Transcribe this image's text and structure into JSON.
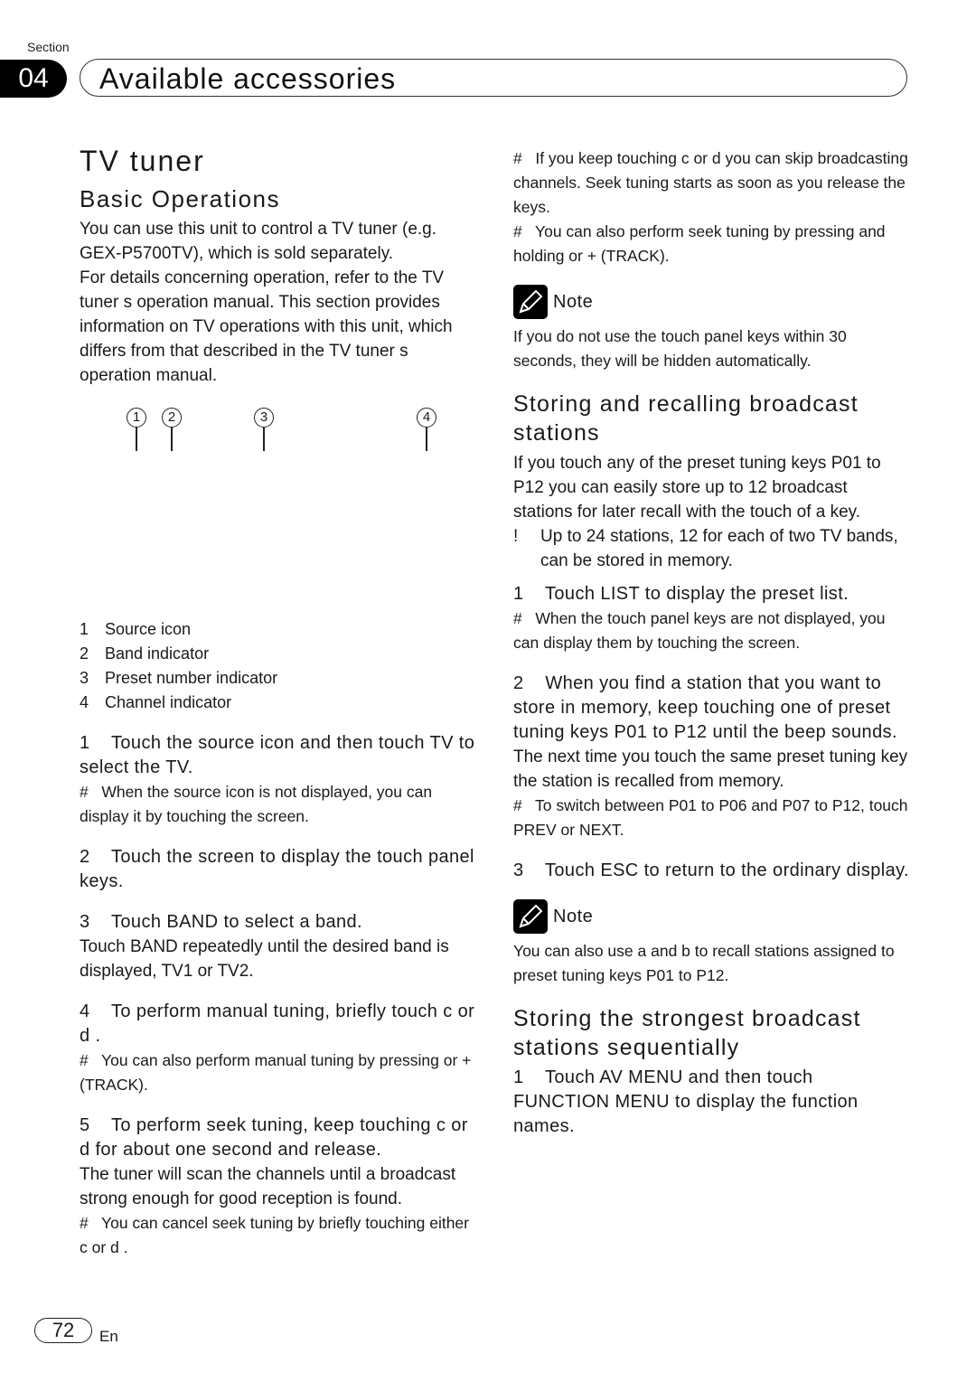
{
  "header": {
    "section_label": "Section",
    "section_number": "04",
    "section_title": "Available accessories"
  },
  "left": {
    "title": "TV tuner",
    "subtitle": "Basic Operations",
    "intro": [
      "You can use this unit to control a TV tuner (e.g. GEX-P5700TV), which is sold separately.",
      "For details concerning operation, refer to the TV tuner s operation manual. This section provides information on TV operations with this unit, which differs from that described in the TV tuner s operation manual."
    ],
    "callouts": [
      "1",
      "2",
      "3",
      "4"
    ],
    "legend": [
      {
        "num": "1",
        "label": "Source icon"
      },
      {
        "num": "2",
        "label": "Band indicator"
      },
      {
        "num": "3",
        "label": "Preset number indicator"
      },
      {
        "num": "4",
        "label": "Channel indicator"
      }
    ],
    "steps": [
      {
        "num": "1",
        "text": "Touch the source icon and then touch TV to select the TV.",
        "body": [],
        "notes": [
          "When the source icon is not displayed, you can display it by touching the screen."
        ]
      },
      {
        "num": "2",
        "text": "Touch the screen to display the touch panel keys.",
        "body": [],
        "notes": []
      },
      {
        "num": "3",
        "text": "Touch BAND to select a band.",
        "body": [
          "Touch BAND repeatedly until the desired band is displayed, TV1 or TV2."
        ],
        "notes": []
      },
      {
        "num": "4",
        "text": "To perform manual tuning, briefly touch c  or d .",
        "body": [],
        "notes": [
          "You can also perform manual tuning by pressing    or +  (TRACK)."
        ]
      },
      {
        "num": "5",
        "text": "To perform seek tuning, keep touching c  or d  for about one second and release.",
        "body": [
          "The tuner will scan the channels until a broadcast strong enough for good reception is found."
        ],
        "notes": [
          "You can cancel seek tuning by briefly touching either c  or d ."
        ]
      }
    ]
  },
  "right": {
    "top_notes": [
      "If you keep touching c  or d  you can skip broadcasting channels. Seek tuning starts as soon as you release the keys.",
      "You can also perform seek tuning by pressing and holding    or +  (TRACK)."
    ],
    "note1": {
      "label": "Note",
      "text": "If you do not use the touch panel keys within 30 seconds, they will be hidden automatically."
    },
    "section2": {
      "title": "Storing and recalling broadcast stations",
      "intro": "If you touch any of the preset tuning keys P01 to P12 you can easily store up to 12 broadcast stations for later recall with the touch of a key.",
      "bullet_mark": "!",
      "bullet": "Up to 24 stations, 12 for each of two TV bands, can be stored in memory.",
      "steps": [
        {
          "num": "1",
          "text": "Touch LIST to display the preset list.",
          "body": [],
          "notes": [
            "When the touch panel keys are not displayed, you can display them by touching the screen."
          ]
        },
        {
          "num": "2",
          "text": "When you find a station that you want to store in memory, keep touching one of preset tuning keys P01 to P12 until the beep sounds.",
          "body": [
            "The next time you touch the same preset tuning key the station is recalled from memory."
          ],
          "notes": [
            "To switch between P01 to P06 and P07 to P12, touch PREV or NEXT."
          ]
        },
        {
          "num": "3",
          "text": "Touch ESC to return to the ordinary display.",
          "body": [],
          "notes": []
        }
      ]
    },
    "note2": {
      "label": "Note",
      "text": "You can also use a  and b  to recall stations assigned to preset tuning keys P01 to P12."
    },
    "section3": {
      "title": "Storing the strongest broadcast stations sequentially",
      "steps": [
        {
          "num": "1",
          "text": "Touch AV MENU and then touch FUNCTION MENU to display the function names."
        }
      ]
    }
  },
  "footer": {
    "page_number": "72",
    "language": "En"
  },
  "icons": {
    "note": "pencil-note-icon",
    "note_mark": "#"
  }
}
